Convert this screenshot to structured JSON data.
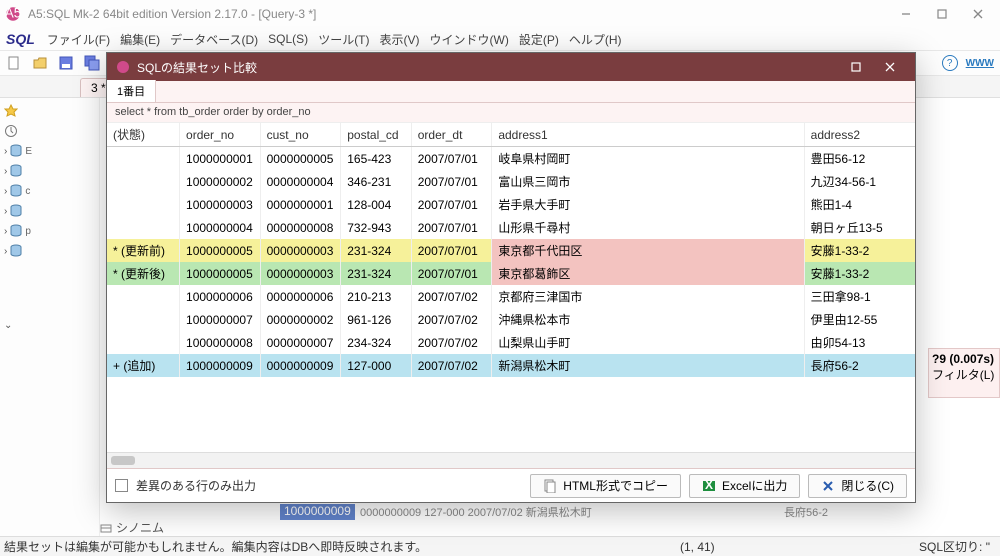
{
  "app": {
    "title": "A5:SQL Mk-2 64bit edition Version 2.17.0 - [Query-3 *]"
  },
  "menubar": {
    "sql_label": "SQL",
    "items": [
      "ファイル(F)",
      "編集(E)",
      "データベース(D)",
      "SQL(S)",
      "ツール(T)",
      "表示(V)",
      "ウインドウ(W)",
      "設定(P)",
      "ヘルプ(H)"
    ]
  },
  "toolbar": {
    "www": "WWW"
  },
  "tabstrip": {
    "tab": "3 *"
  },
  "sidebar": {
    "synonym": "シノニム"
  },
  "result_strip": {
    "header": "?9 (0.007s)",
    "filter": "フィルタ(L)"
  },
  "statusbar": {
    "left": "結果セットは編集が可能かもしれません。編集内容はDBへ即時反映されます。",
    "cursor": "(1, 41)",
    "right": "SQL区切り: \""
  },
  "under": {
    "selected": "1000000009",
    "rest": " 0000000009 127-000  2007/07/02 新潟県松木町",
    "right": "長府56-2"
  },
  "dialog": {
    "title": "SQLの結果セット比較",
    "tab": "1番目",
    "sql": "select * from tb_order order by order_no",
    "columns": {
      "state": "(状態)",
      "order_no": "order_no",
      "cust_no": "cust_no",
      "postal_cd": "postal_cd",
      "order_dt": "order_dt",
      "address1": "address1",
      "address2": "address2"
    },
    "rows": [
      {
        "state": "",
        "order_no": "1000000001",
        "cust_no": "0000000005",
        "postal": "165-423",
        "date": "2007/07/01",
        "addr1": "岐阜県村岡町",
        "addr2": "豊田56-12",
        "cls": "r-normal"
      },
      {
        "state": "",
        "order_no": "1000000002",
        "cust_no": "0000000004",
        "postal": "346-231",
        "date": "2007/07/01",
        "addr1": "富山県三岡市",
        "addr2": "九辺34-56-1",
        "cls": "r-normal"
      },
      {
        "state": "",
        "order_no": "1000000003",
        "cust_no": "0000000001",
        "postal": "128-004",
        "date": "2007/07/01",
        "addr1": "岩手県大手町",
        "addr2": "熊田1-4",
        "cls": "r-normal"
      },
      {
        "state": "",
        "order_no": "1000000004",
        "cust_no": "0000000008",
        "postal": "732-943",
        "date": "2007/07/01",
        "addr1": "山形県千尋村",
        "addr2": "朝日ヶ丘13-5",
        "cls": "r-normal"
      },
      {
        "state": "* (更新前)",
        "order_no": "1000000005",
        "cust_no": "0000000003",
        "postal": "231-324",
        "date": "2007/07/01",
        "addr1": "東京都千代田区",
        "addr2": "安藤1-33-2",
        "cls": "r-before"
      },
      {
        "state": "* (更新後)",
        "order_no": "1000000005",
        "cust_no": "0000000003",
        "postal": "231-324",
        "date": "2007/07/01",
        "addr1": "東京都葛飾区",
        "addr2": "安藤1-33-2",
        "cls": "r-after"
      },
      {
        "state": "",
        "order_no": "1000000006",
        "cust_no": "0000000006",
        "postal": "210-213",
        "date": "2007/07/02",
        "addr1": "京都府三津国市",
        "addr2": "三田拿98-1",
        "cls": "r-normal"
      },
      {
        "state": "",
        "order_no": "1000000007",
        "cust_no": "0000000002",
        "postal": "961-126",
        "date": "2007/07/02",
        "addr1": "沖縄県松本市",
        "addr2": "伊里由12-55",
        "cls": "r-normal"
      },
      {
        "state": "",
        "order_no": "1000000008",
        "cust_no": "0000000007",
        "postal": "234-324",
        "date": "2007/07/02",
        "addr1": "山梨県山手町",
        "addr2": "由卯54-13",
        "cls": "r-normal"
      },
      {
        "state": "+ (追加)",
        "order_no": "1000000009",
        "cust_no": "0000000009",
        "postal": "127-000",
        "date": "2007/07/02",
        "addr1": "新潟県松木町",
        "addr2": "長府56-2",
        "cls": "r-add"
      }
    ],
    "footer": {
      "diff_only": "差異のある行のみ出力",
      "btn_html": "HTML形式でコピー",
      "btn_excel": "Excelに出力",
      "btn_close": "閉じる(C)"
    }
  }
}
